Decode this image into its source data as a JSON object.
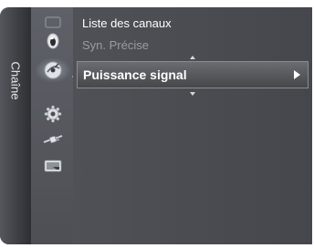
{
  "side_tab": {
    "label": "Chaîne"
  },
  "icons": [
    {
      "name": "picture-icon",
      "selected": false
    },
    {
      "name": "sound-icon",
      "selected": false
    },
    {
      "name": "channel-satellite-icon",
      "selected": true
    },
    {
      "name": "setup-gear-icon",
      "selected": false
    },
    {
      "name": "input-plug-icon",
      "selected": false
    },
    {
      "name": "application-screen-icon",
      "selected": false
    }
  ],
  "menu": {
    "items": [
      {
        "label": "Liste des canaux",
        "state": "normal"
      },
      {
        "label": "Syn. Précise",
        "state": "disabled"
      },
      {
        "label": "Puissance signal",
        "state": "selected",
        "has_submenu": true
      }
    ]
  },
  "colors": {
    "panel_bg": "#45474c",
    "icon_column_bg": "#55575d",
    "text_normal": "#ffffff",
    "text_disabled": "#9a9ca1"
  }
}
